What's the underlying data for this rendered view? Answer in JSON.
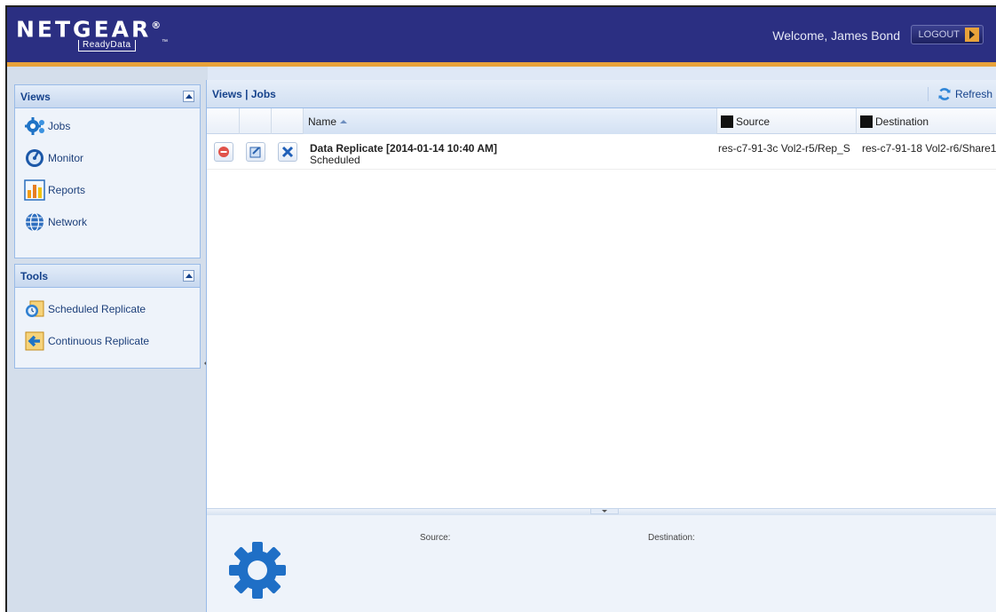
{
  "header": {
    "brand": "NETGEAR",
    "brand_mark": "®",
    "product": "ReadyData",
    "product_mark": "™",
    "welcome": "Welcome, James Bond",
    "logout": "LOGOUT"
  },
  "sidebar": {
    "views": {
      "title": "Views",
      "items": [
        {
          "label": "Jobs",
          "icon": "jobs-gear-icon"
        },
        {
          "label": "Monitor",
          "icon": "monitor-gauge-icon"
        },
        {
          "label": "Reports",
          "icon": "reports-chart-icon"
        },
        {
          "label": "Network",
          "icon": "network-globe-icon"
        }
      ]
    },
    "tools": {
      "title": "Tools",
      "items": [
        {
          "label": "Scheduled Replicate",
          "icon": "scheduled-replicate-icon"
        },
        {
          "label": "Continuous Replicate",
          "icon": "continuous-replicate-icon"
        }
      ]
    }
  },
  "main": {
    "title": "Views | Jobs",
    "refresh": "Refresh",
    "columns": {
      "name": "Name",
      "source": "Source",
      "destination": "Destination"
    },
    "rows": [
      {
        "name": "Data Replicate [2014-01-14 10:40 AM]",
        "status": "Scheduled",
        "source": "res-c7-91-3c Vol2-r5/Rep_S",
        "destination": "res-c7-91-18 Vol2-r6/Share1"
      }
    ],
    "details": {
      "source_label": "Source:",
      "destination_label": "Destination:"
    }
  },
  "colors": {
    "header_bg": "#2b2f82",
    "header_stripe": "#e8a23a",
    "panel_border": "#99bbe8",
    "title_text": "#15428b"
  }
}
